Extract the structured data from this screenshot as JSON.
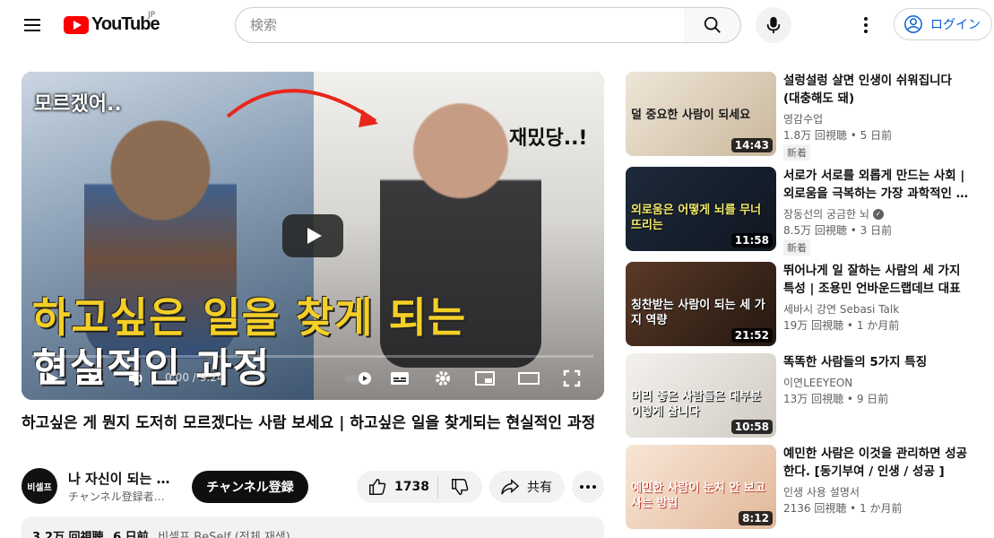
{
  "header": {
    "logo_text": "YouTube",
    "region": "JP",
    "search_placeholder": "検索",
    "login_label": "ログイン"
  },
  "player": {
    "thumb_text_top_left": "모르겠어..",
    "thumb_text_top_right": "재밌당..!",
    "thumb_line1": "하고싶은 일을 찾게 되는",
    "thumb_line2": "현실적인 과정",
    "time": "0:00 / 9:24",
    "progress_fraction": 0.0
  },
  "video": {
    "title": "하고싶은 게 뭔지 도저히 모르겠다는 사람 보세요 | 하고싶은 일을 찾게되는 현실적인 과정",
    "channel_avatar_text": "비셀프",
    "channel_name": "나 자신이 되는 …",
    "channel_sub": "チャンネル登録者…",
    "subscribe_label": "チャンネル登録",
    "like_count": "1738",
    "share_label": "共有",
    "views": "3.2万 回視聴",
    "date": "6 日前",
    "desc_preview": "비셀프 BeSelf (전체 재생)"
  },
  "recommendations": [
    {
      "title": "설렁설렁 살면 인생이 쉬워집니다 (대충해도 돼)",
      "channel": "영감수업",
      "verified": false,
      "views": "1.8万 回視聴",
      "age": "5 日前",
      "badge": "新着",
      "duration": "14:43",
      "thumb_caption": "덜 중요한 사람이 되세요",
      "accent": "#d9c3a5"
    },
    {
      "title": "서로가 서로를 외롭게 만드는 사회 | 외로움을 극복하는 가장 과학적인 …",
      "channel": "장동선의 궁금한 뇌",
      "verified": true,
      "views": "8.5万 回視聴",
      "age": "3 日前",
      "badge": "新着",
      "duration": "11:58",
      "thumb_caption": "외로움은 어떻게 뇌를 무너뜨리는",
      "accent": "#1d2a3a"
    },
    {
      "title": "뛰어나게 일 잘하는 사람의 세 가지 특성 | 조용민 언바운드랩데브 대표 …",
      "channel": "세바시 강연 Sebasi Talk",
      "verified": false,
      "views": "19万 回視聴",
      "age": "1 か月前",
      "badge": "",
      "duration": "21:52",
      "thumb_caption": "칭찬받는 사람이 되는 세 가지 역량",
      "accent": "#3a2a20"
    },
    {
      "title": "똑똑한 사람들의 5가지 특징",
      "channel": "이연LEEYEON",
      "verified": false,
      "views": "13万 回視聴",
      "age": "9 日前",
      "badge": "",
      "duration": "10:58",
      "thumb_caption": "머리 좋은 사람들은 대부분 이렇게 삽니다",
      "accent": "#e9e5de"
    },
    {
      "title": "예민한 사람은 이것을 관리하면 성공한다. [동기부여 / 인생 / 성공 ]",
      "channel": "인생 사용 설명서",
      "verified": false,
      "views": "2136 回視聴",
      "age": "1 か月前",
      "badge": "",
      "duration": "8:12",
      "thumb_caption": "예민한 사람이 눈치 안 보고 사는 방법",
      "accent": "#f0d8c4"
    }
  ]
}
